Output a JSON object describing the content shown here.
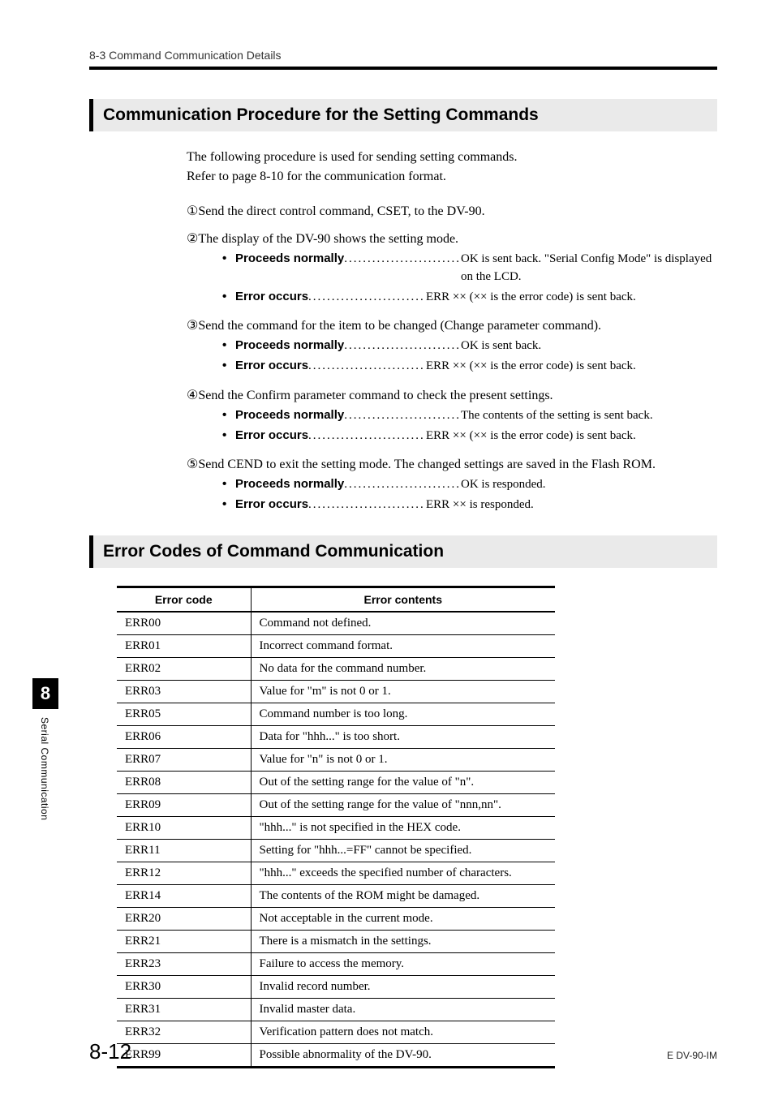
{
  "header": {
    "breadcrumb": "8-3 Command Communication Details"
  },
  "section1": {
    "heading": "Communication Procedure for the Setting Commands",
    "intro1": "The following procedure is used for sending setting commands.",
    "intro2": "Refer to page 8-10 for the communication format.",
    "steps": [
      {
        "num": "①",
        "title": "Send the direct control command, CSET, to the DV-90.",
        "items": []
      },
      {
        "num": "②",
        "title": "The display of the DV-90 shows the setting mode.",
        "items": [
          {
            "label": "Proceeds normally",
            "result": "OK is sent back. \"Serial Config Mode\" is displayed on the LCD."
          },
          {
            "label": "Error occurs",
            "result": "ERR ×× (×× is the error code) is sent back."
          }
        ]
      },
      {
        "num": "③",
        "title": "Send the command for the item to be changed (Change parameter command).",
        "items": [
          {
            "label": "Proceeds normally",
            "result": "OK is sent back."
          },
          {
            "label": "Error occurs",
            "result": "ERR ×× (×× is the error code) is sent back."
          }
        ]
      },
      {
        "num": "④",
        "title": "Send the Confirm parameter command to check the present settings.",
        "items": [
          {
            "label": "Proceeds normally",
            "result": "The contents of the setting is sent back."
          },
          {
            "label": "Error occurs",
            "result": "ERR ×× (×× is the error code) is sent back."
          }
        ]
      },
      {
        "num": "⑤",
        "title": "Send CEND to exit the setting mode. The changed settings are saved in the Flash ROM.",
        "items": [
          {
            "label": "Proceeds normally",
            "result": "OK is responded."
          },
          {
            "label": "Error occurs",
            "result": "ERR ×× is responded."
          }
        ]
      }
    ]
  },
  "section2": {
    "heading": "Error Codes of Command Communication",
    "columns": {
      "code": "Error code",
      "contents": "Error contents"
    },
    "rows": [
      {
        "code": "ERR00",
        "contents": "Command not defined."
      },
      {
        "code": "ERR01",
        "contents": "Incorrect command format."
      },
      {
        "code": "ERR02",
        "contents": "No data for the command number."
      },
      {
        "code": "ERR03",
        "contents": "Value for \"m\" is not 0 or 1."
      },
      {
        "code": "ERR05",
        "contents": "Command number is too long."
      },
      {
        "code": "ERR06",
        "contents": "Data for \"hhh...\" is too short."
      },
      {
        "code": "ERR07",
        "contents": "Value for \"n\" is not 0 or 1."
      },
      {
        "code": "ERR08",
        "contents": "Out of the setting range for the value of \"n\"."
      },
      {
        "code": "ERR09",
        "contents": "Out of the setting range for the value of \"nnn,nn\"."
      },
      {
        "code": "ERR10",
        "contents": "\"hhh...\" is not specified in the HEX code."
      },
      {
        "code": "ERR11",
        "contents": "Setting for \"hhh...=FF\" cannot be specified."
      },
      {
        "code": "ERR12",
        "contents": "\"hhh...\" exceeds the specified number of characters."
      },
      {
        "code": "ERR14",
        "contents": "The contents of the ROM might be damaged."
      },
      {
        "code": "ERR20",
        "contents": "Not acceptable in the current mode."
      },
      {
        "code": "ERR21",
        "contents": "There is a mismatch in the settings."
      },
      {
        "code": "ERR23",
        "contents": "Failure to access the memory."
      },
      {
        "code": "ERR30",
        "contents": "Invalid record number."
      },
      {
        "code": "ERR31",
        "contents": "Invalid master data."
      },
      {
        "code": "ERR32",
        "contents": "Verification pattern does not match."
      },
      {
        "code": "ERR99",
        "contents": "Possible abnormality of the DV-90."
      }
    ]
  },
  "sidebar": {
    "chapter": "8",
    "label": "Serial Communication"
  },
  "footer": {
    "page": "8-12",
    "doc": "E DV-90-IM"
  },
  "dots": "........................."
}
